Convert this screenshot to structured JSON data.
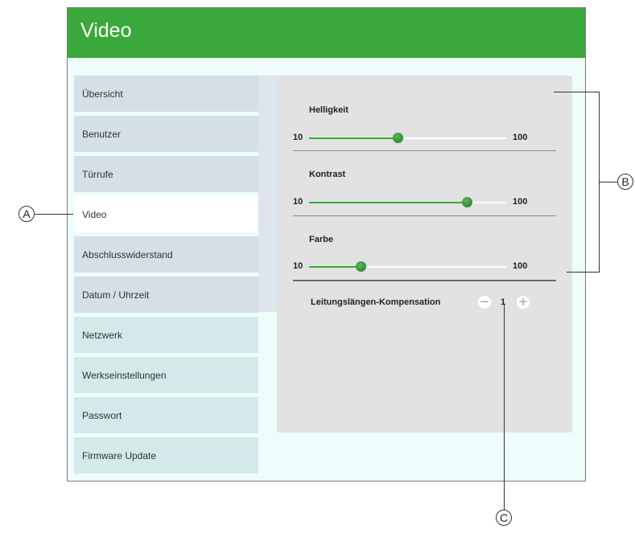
{
  "window": {
    "title": "Video"
  },
  "sidebar": {
    "items": [
      {
        "label": "Übersicht"
      },
      {
        "label": "Benutzer"
      },
      {
        "label": "Türrufe"
      },
      {
        "label": "Video"
      },
      {
        "label": "Abschlusswiderstand"
      },
      {
        "label": "Datum / Uhrzeit"
      },
      {
        "label": "Netzwerk"
      },
      {
        "label": "Werkseinstellungen"
      },
      {
        "label": "Passwort"
      },
      {
        "label": "Firmware Update"
      }
    ],
    "selected": "Video"
  },
  "sliders": [
    {
      "label": "Helligkeit",
      "min": "10",
      "max": "100",
      "value": 45
    },
    {
      "label": "Kontrast",
      "min": "10",
      "max": "100",
      "value": 80
    },
    {
      "label": "Farbe",
      "min": "10",
      "max": "100",
      "value": 26
    }
  ],
  "compensation": {
    "label": "Leitungslängen-Kompensation",
    "value": "1"
  },
  "callouts": {
    "a": "A",
    "b": "B",
    "c": "C"
  },
  "colors": {
    "accent": "#3aa83a",
    "header_bg": "#3aa83a",
    "panel_bg": "#e2e2e2"
  }
}
